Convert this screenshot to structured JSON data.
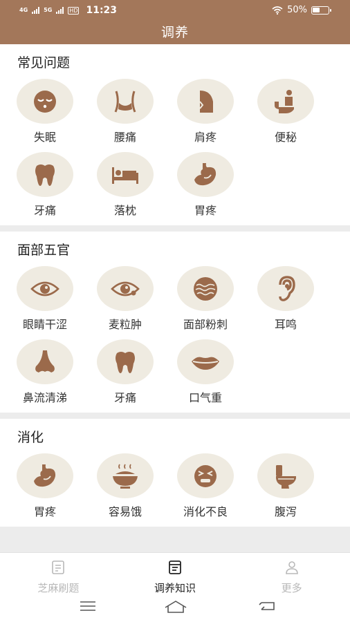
{
  "status_bar": {
    "network1": "4G",
    "network2": "5G",
    "hd": "HD",
    "time": "11:23",
    "battery": "50%"
  },
  "header": {
    "title": "调养"
  },
  "sections": [
    {
      "title": "常见问题",
      "items": [
        {
          "label": "失眠",
          "icon": "sleepy-face-icon"
        },
        {
          "label": "腰痛",
          "icon": "waist-icon"
        },
        {
          "label": "肩疼",
          "icon": "shoulder-icon"
        },
        {
          "label": "便秘",
          "icon": "toilet-person-icon"
        },
        {
          "label": "牙痛",
          "icon": "tooth-icon"
        },
        {
          "label": "落枕",
          "icon": "bed-icon"
        },
        {
          "label": "胃疼",
          "icon": "stomach-icon"
        }
      ]
    },
    {
      "title": "面部五官",
      "items": [
        {
          "label": "眼睛干涩",
          "icon": "eye-icon"
        },
        {
          "label": "麦粒肿",
          "icon": "stye-eye-icon"
        },
        {
          "label": "面部粉刺",
          "icon": "acne-face-icon"
        },
        {
          "label": "耳鸣",
          "icon": "ear-icon"
        },
        {
          "label": "鼻流清涕",
          "icon": "nose-icon"
        },
        {
          "label": "牙痛",
          "icon": "tooth-icon"
        },
        {
          "label": "口气重",
          "icon": "lips-icon"
        }
      ]
    },
    {
      "title": "消化",
      "items": [
        {
          "label": "胃疼",
          "icon": "stomach-icon"
        },
        {
          "label": "容易饿",
          "icon": "bowl-icon"
        },
        {
          "label": "消化不良",
          "icon": "squint-face-icon"
        },
        {
          "label": "腹泻",
          "icon": "toilet-icon"
        }
      ]
    }
  ],
  "tabbar": {
    "tabs": [
      {
        "label": "芝麻刷题",
        "icon": "exam-icon",
        "active": false
      },
      {
        "label": "调养知识",
        "icon": "notes-icon",
        "active": true
      },
      {
        "label": "更多",
        "icon": "person-icon",
        "active": false
      }
    ]
  },
  "colors": {
    "accent": "#a3775a",
    "icon": "#9b6a4b",
    "icon_bg": "#efebe1"
  }
}
